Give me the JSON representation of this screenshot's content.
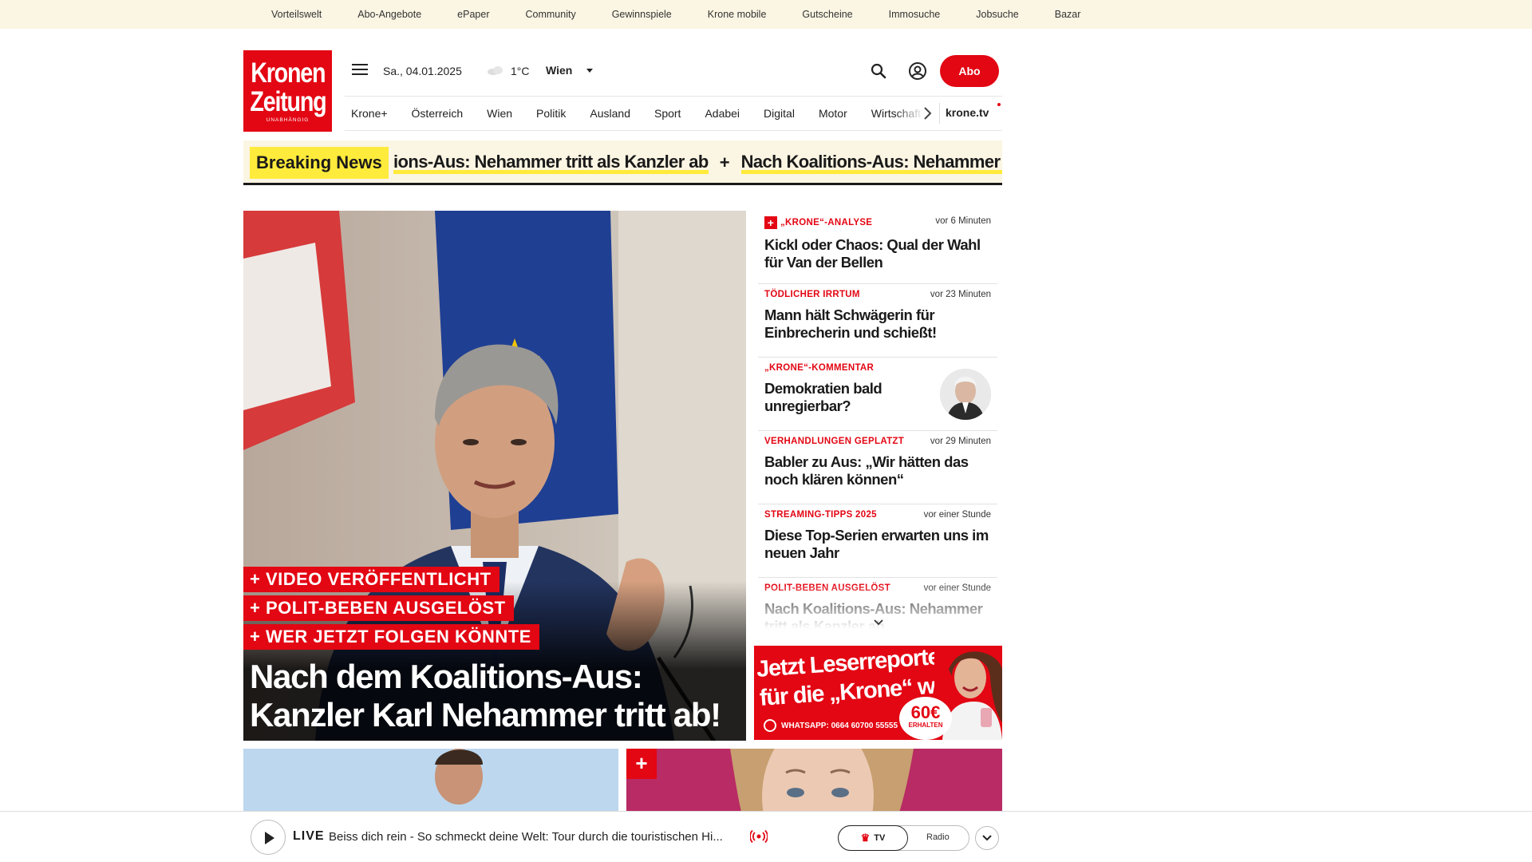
{
  "topbar": {
    "links": [
      "Vorteilswelt",
      "Abo-Angebote",
      "ePaper",
      "Community",
      "Gewinnspiele",
      "Krone mobile",
      "Gutscheine",
      "Immosuche",
      "Jobsuche",
      "Bazar"
    ]
  },
  "logo": {
    "line1": "Kronen",
    "line2": "Zeitung",
    "tagline": "UNABHÄNGIG"
  },
  "header": {
    "date": "Sa., 04.01.2025",
    "weather_icon": "cloud-icon",
    "temperature": "1°C",
    "city": "Wien",
    "abo_label": "Abo"
  },
  "nav": {
    "items": [
      "Krone+",
      "Österreich",
      "Wien",
      "Politik",
      "Ausland",
      "Sport",
      "Adabei",
      "Digital",
      "Motor",
      "Wirtschaft"
    ],
    "tv_label": "krone.tv"
  },
  "ticker": {
    "label": "Breaking News",
    "items": [
      "ions-Aus: Nehammer tritt als Kanzler ab",
      "Nach Koalitions-Aus: Nehammer tritt als Kanzler ab"
    ],
    "separator": "+"
  },
  "hero": {
    "tags": [
      "+ VIDEO VERÖFFENTLICHT",
      "+ POLIT-BEBEN AUSGELÖST",
      "+ WER JETZT FOLGEN KÖNNTE"
    ],
    "headline_line1": "Nach dem Koalitions-Aus:",
    "headline_line2": "Kanzler Karl Nehammer tritt ab!"
  },
  "side_stories": [
    {
      "kicker": "„KRONE“-ANALYSE",
      "plus": true,
      "time": "vor 6 Minuten",
      "title": "Kickl oder Chaos: Qual der Wahl für Van der Bellen"
    },
    {
      "kicker": "TÖDLICHER IRRTUM",
      "plus": false,
      "time": "vor 23 Minuten",
      "title": "Mann hält Schwägerin für Einbrecherin und schießt!"
    },
    {
      "kicker": "„KRONE“-KOMMENTAR",
      "plus": false,
      "time": "",
      "title": "Demokratien bald unregierbar?",
      "avatar": true
    },
    {
      "kicker": "VERHANDLUNGEN GEPLATZT",
      "plus": false,
      "time": "vor 29 Minuten",
      "title": "Babler zu Aus: „Wir hätten das noch klären können“"
    },
    {
      "kicker": "STREAMING-TIPPS 2025",
      "plus": false,
      "time": "vor einer Stunde",
      "title": "Diese Top-Serien erwarten uns im neuen Jahr"
    },
    {
      "kicker": "POLIT-BEBEN AUSGELÖST",
      "plus": false,
      "time": "vor einer Stunde",
      "title": "Nach Koalitions-Aus: Nehammer tritt als Kanzler ab"
    }
  ],
  "ad": {
    "line1": "Jetzt Leserreporter",
    "line2": "für die „Krone“ werden",
    "whatsapp": "WHATSAPP: 0664 60700 55555",
    "amount": "60€",
    "amount_sub": "ERHALTEN"
  },
  "carousel": {
    "active": 1,
    "count": 4
  },
  "player": {
    "live_label": "LIVE",
    "now_playing": "Beiss dich rein - So schmeckt deine Welt: Tour durch die touristischen Hi...",
    "tv_label": "TV",
    "radio_label": "Radio"
  },
  "colors": {
    "brand_red": "#e30613",
    "ticker_bg": "#fbf5e3",
    "highlight_yellow": "#ffeb3b"
  }
}
